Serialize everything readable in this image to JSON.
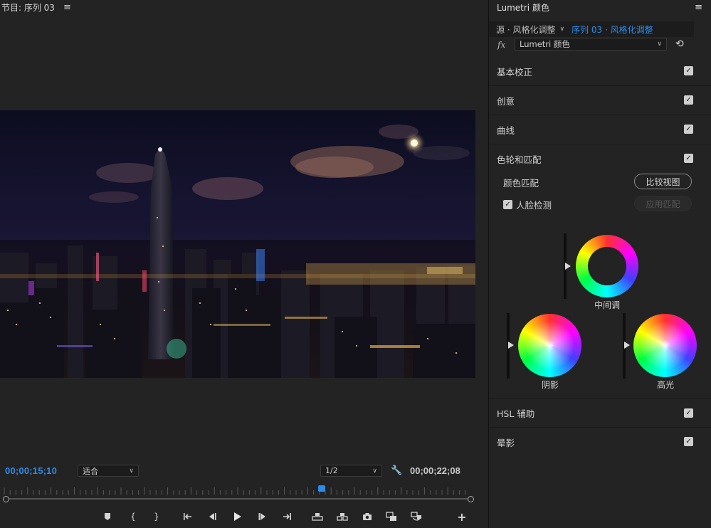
{
  "program_monitor": {
    "title": "节目: 序列 03",
    "timecode_current": "00;00;15;10",
    "timecode_duration": "00;00;22;08",
    "zoom_select": "适合",
    "resolution_select": "1/2",
    "playhead_fraction": 0.68
  },
  "lumetri": {
    "title": "Lumetri 颜色",
    "source_label": "源 · 风格化调整",
    "sequence_label": "序列 03 · 风格化调整",
    "fx_label": "fx",
    "effect_name": "Lumetri 颜色",
    "sections": {
      "basic": "基本校正",
      "creative": "创意",
      "curves": "曲线",
      "color_wheels": "色轮和匹配",
      "hsl": "HSL 辅助",
      "vignette": "晕影"
    },
    "color_match_label": "颜色匹配",
    "compare_view_button": "比较视图",
    "face_detect_label": "人脸检测",
    "apply_match_button": "应用匹配",
    "wheels": {
      "midtones": "中间调",
      "shadows": "阴影",
      "highlights": "高光"
    }
  },
  "colors": {
    "accent_blue": "#2d8ceb",
    "panel_bg": "#232323"
  }
}
